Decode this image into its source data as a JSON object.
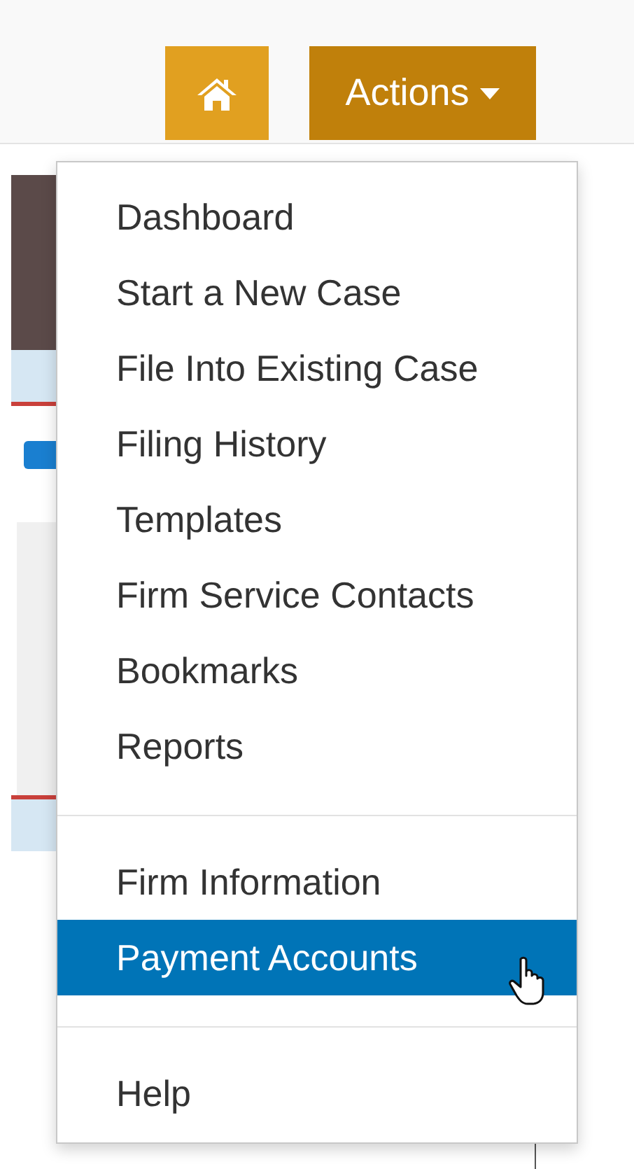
{
  "header": {
    "actions_button": {
      "label": "Actions"
    }
  },
  "actions_menu": {
    "groups": [
      {
        "items": [
          {
            "label": "Dashboard",
            "selected": false
          },
          {
            "label": "Start a New Case",
            "selected": false
          },
          {
            "label": "File Into Existing Case",
            "selected": false
          },
          {
            "label": "Filing History",
            "selected": false
          },
          {
            "label": "Templates",
            "selected": false
          },
          {
            "label": "Firm Service Contacts",
            "selected": false
          },
          {
            "label": "Bookmarks",
            "selected": false
          },
          {
            "label": "Reports",
            "selected": false
          }
        ]
      },
      {
        "items": [
          {
            "label": "Firm Information",
            "selected": false
          },
          {
            "label": "Payment Accounts",
            "selected": true
          }
        ]
      },
      {
        "items": [
          {
            "label": "Help",
            "selected": false
          }
        ]
      }
    ]
  }
}
